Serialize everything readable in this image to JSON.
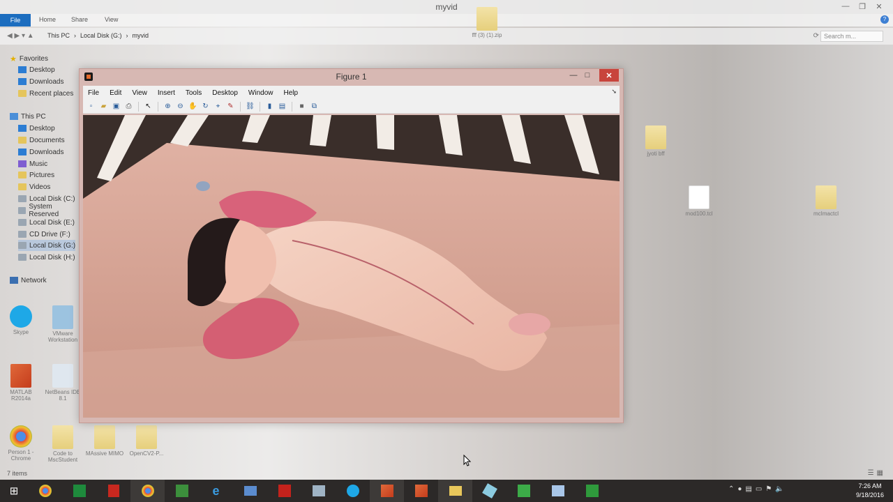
{
  "explorer": {
    "title": "myvid",
    "tabs": [
      "File",
      "Home",
      "Share",
      "View"
    ],
    "breadcrumb": [
      "This PC",
      "Local Disk (G:)",
      "myvid"
    ],
    "search_placeholder": "Search m...",
    "nav": [
      {
        "label": "Favorites",
        "icon": "star-icon"
      },
      {
        "label": "Desktop",
        "icon": "desktop-icon"
      },
      {
        "label": "Downloads",
        "icon": "downloads-icon"
      },
      {
        "label": "Recent places",
        "icon": "recent-places-icon"
      },
      {
        "label": "This PC",
        "icon": "pc-icon"
      },
      {
        "label": "Desktop",
        "icon": "desktop-icon"
      },
      {
        "label": "Documents",
        "icon": "documents-icon"
      },
      {
        "label": "Downloads",
        "icon": "downloads-icon"
      },
      {
        "label": "Music",
        "icon": "music-icon"
      },
      {
        "label": "Pictures",
        "icon": "pictures-icon"
      },
      {
        "label": "Videos",
        "icon": "videos-icon"
      },
      {
        "label": "Local Disk (C:)",
        "icon": "drive-icon"
      },
      {
        "label": "System Reserved",
        "icon": "drive-icon"
      },
      {
        "label": "Local Disk (E:)",
        "icon": "drive-icon"
      },
      {
        "label": "CD Drive (F:)",
        "icon": "cd-drive-icon"
      },
      {
        "label": "Local Disk (G:)",
        "icon": "drive-icon"
      },
      {
        "label": "Local Disk (H:)",
        "icon": "drive-icon"
      },
      {
        "label": "Network",
        "icon": "network-icon"
      }
    ],
    "status": "7 items"
  },
  "desktop_icons": [
    {
      "label": "fff (3) (1).zip",
      "icon": "zip-folder-icon"
    },
    {
      "label": "jyoti bff",
      "icon": "folder-icon"
    },
    {
      "label": "mod100.tcl",
      "icon": "file-icon"
    },
    {
      "label": "mcImactcl",
      "icon": "folder-icon"
    },
    {
      "label": "Skype",
      "icon": "skype-icon"
    },
    {
      "label": "VMware Workstation",
      "icon": "vmware-icon"
    },
    {
      "label": "MATLAB R2014a",
      "icon": "matlab-icon"
    },
    {
      "label": "NetBeans IDE 8.1",
      "icon": "netbeans-icon"
    },
    {
      "label": "Person 1 - Chrome",
      "icon": "chrome-icon"
    },
    {
      "label": "Code to MscStudent",
      "icon": "folder-icon"
    },
    {
      "label": "MAssive MIMO",
      "icon": "folder-icon"
    },
    {
      "label": "OpenCV2-P...",
      "icon": "folder-icon"
    }
  ],
  "figure": {
    "title": "Figure 1",
    "menu": [
      "File",
      "Edit",
      "View",
      "Insert",
      "Tools",
      "Desktop",
      "Window",
      "Help"
    ],
    "toolbar": [
      "new-figure-icon",
      "open-file-icon",
      "save-icon",
      "print-icon",
      "arrow-pointer-icon",
      "zoom-in-icon",
      "zoom-out-icon",
      "pan-hand-icon",
      "rotate-3d-icon",
      "data-cursor-icon",
      "brush-icon",
      "link-plot-icon",
      "colorbar-icon",
      "legend-icon",
      "hide-plot-tools-icon",
      "show-plot-tools-icon"
    ]
  },
  "taskbar": {
    "time": "7:26 AM",
    "date": "9/18/2016",
    "apps": [
      "start-icon",
      "chrome-icon",
      "excel-icon",
      "acrobat-reader-icon",
      "chrome-icon",
      "vdi-icon",
      "internet-explorer-icon",
      "network-tool-icon",
      "acrobat-icon",
      "calculator-icon",
      "skype-icon",
      "matlab-icon",
      "matlab-icon",
      "file-explorer-icon",
      "gadget-icon",
      "camtasia-icon",
      "paint-icon",
      "camtasia-recorder-icon"
    ]
  },
  "colors": {
    "accent": "#1c6dbf",
    "taskbar": "#2c2928",
    "close_button": "#c8443c"
  }
}
